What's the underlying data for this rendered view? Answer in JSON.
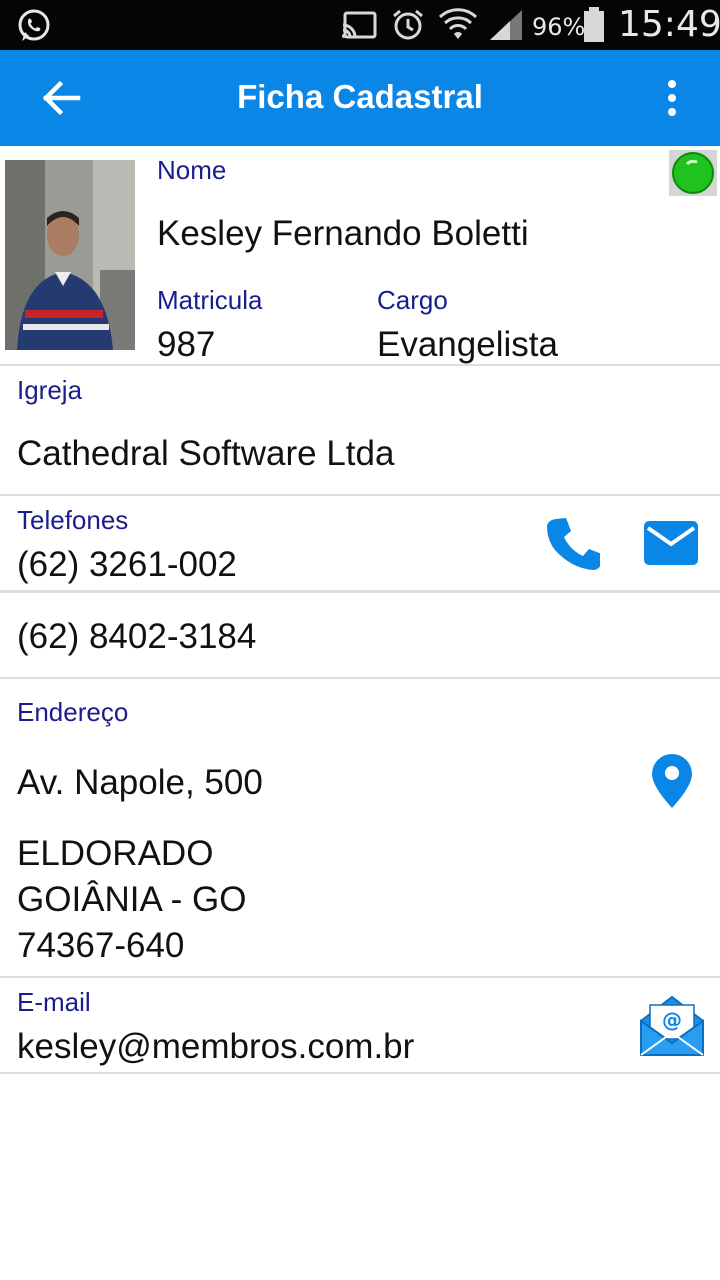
{
  "status_bar": {
    "battery": "96%",
    "time": "15:49",
    "icons": [
      "whatsapp-icon",
      "cast-icon",
      "alarm-icon",
      "wifi-icon",
      "signal-icon",
      "battery-icon"
    ]
  },
  "app_bar": {
    "title": "Ficha Cadastral",
    "background": "#0a86e6",
    "icons": [
      "back-arrow-icon",
      "more-vert-icon"
    ]
  },
  "profile": {
    "name_label": "Nome",
    "name": "Kesley Fernando Boletti",
    "matricula_label": "Matricula",
    "matricula": "987",
    "cargo_label": "Cargo",
    "cargo": "Evangelista",
    "status_color": "#1fc21f"
  },
  "igreja": {
    "label": "Igreja",
    "value": "Cathedral Software Ltda"
  },
  "telefones": {
    "label": "Telefones",
    "phone1": "(62) 3261-002",
    "phone2": "(62) 8402-3184",
    "icons": [
      "phone-icon",
      "message-icon"
    ]
  },
  "endereco": {
    "label": "Endereço",
    "street": "Av. Napole, 500",
    "district": "ELDORADO",
    "city": "GOIÂNIA - GO",
    "zip": "74367-640",
    "icons": [
      "map-pin-icon"
    ]
  },
  "email": {
    "label": "E-mail",
    "value": "kesley@membros.com.br",
    "icons": [
      "email-open-icon"
    ]
  },
  "colors": {
    "accent": "#0a86e6",
    "label_text": "#1a1e8c",
    "divider": "#dedede"
  }
}
